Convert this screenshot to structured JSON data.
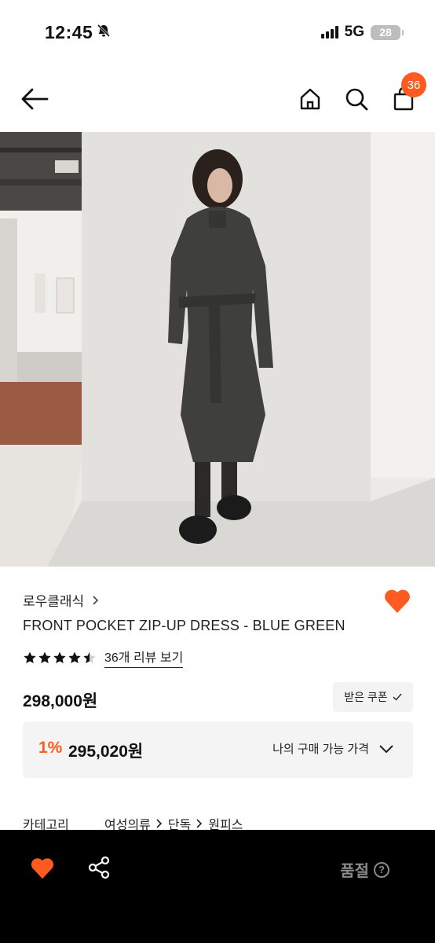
{
  "status_bar": {
    "time": "12:45",
    "network": "5G",
    "battery": "28"
  },
  "header": {
    "cart_count": "36"
  },
  "product": {
    "brand": "로우클래식",
    "name": "FRONT POCKET ZIP-UP DRESS - BLUE GREEN",
    "rating": 4.5,
    "review_link": "36개 리뷰 보기",
    "price": "298,000원",
    "coupon_label": "받은 쿠폰",
    "discount_rate": "1%",
    "discount_price": "295,020원",
    "purchase_label": "나의 구매 가능 가격"
  },
  "category": {
    "label": "카테고리",
    "path": [
      "여성의류",
      "단독",
      "원피스"
    ]
  },
  "bottom_bar": {
    "sold_out_label": "품절"
  },
  "colors": {
    "accent": "#ff5a1f",
    "bottom_bar": "#000000",
    "disabled_text": "#8a8a8a"
  }
}
